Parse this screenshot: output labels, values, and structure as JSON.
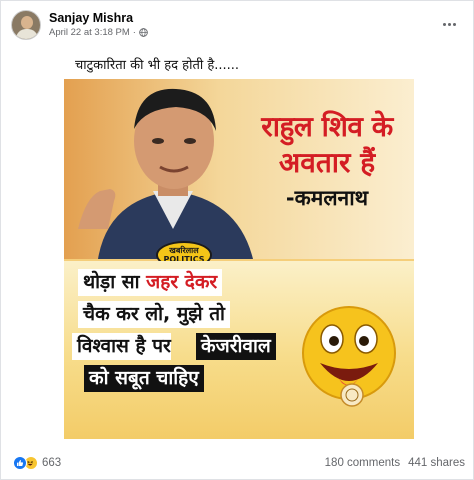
{
  "post": {
    "author": "Sanjay Mishra",
    "date": "April 22 at 3:18 PM",
    "separator": "·",
    "caption": "चाटुकारिता की भी हद होती है......"
  },
  "meme": {
    "headline_line1": "राहुल शिव के",
    "headline_line2": "अवतार हैं",
    "headline_attrib": "-कमलनाथ",
    "badge_top": "खबरिलाल",
    "badge_bottom": "POLITICS",
    "quote": {
      "l1_a": "थोड़ा सा ",
      "l1_b": "जहर देकर",
      "l2": "चैक कर लो, मुझे तो",
      "l3_a": "विश्वास है पर",
      "l3_b": "केजरीवाल",
      "l4": "को सबूत चाहिए"
    }
  },
  "stats": {
    "reactions": "663",
    "comments": "180 comments",
    "shares": "441 shares"
  },
  "icons": {
    "like": "like-icon",
    "haha": "haha-icon",
    "globe": "globe-icon",
    "more": "more-icon"
  },
  "colors": {
    "like_blue": "#1877f2",
    "meta_gray": "#65676b",
    "headline_red": "#d41d24"
  }
}
